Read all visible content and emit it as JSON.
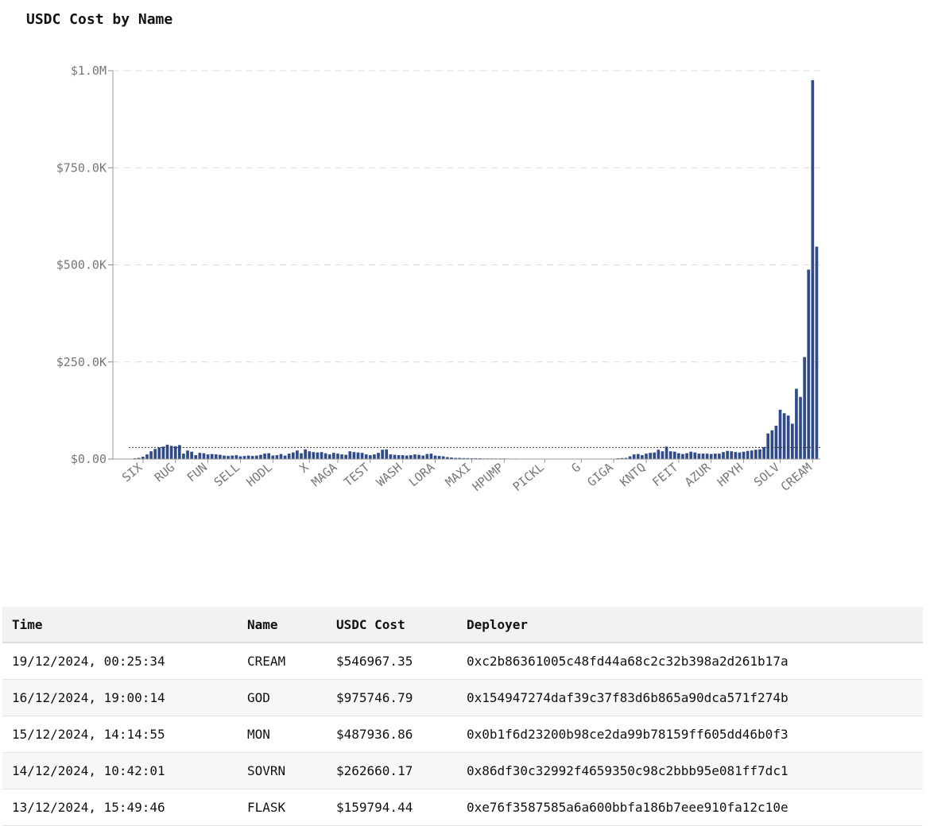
{
  "chart_title": "USDC Cost by Name",
  "chart_data": {
    "type": "bar",
    "title": "USDC Cost by Name",
    "ylim": [
      0,
      1000000
    ],
    "yticks": [
      {
        "value": 0,
        "label": "$0.00"
      },
      {
        "value": 250000,
        "label": "$250.0K"
      },
      {
        "value": 500000,
        "label": "$500.0K"
      },
      {
        "value": 750000,
        "label": "$750.0K"
      },
      {
        "value": 1000000,
        "label": "$1.0M"
      }
    ],
    "x_tick_labels": [
      {
        "index": 3,
        "label": "SIX"
      },
      {
        "index": 11,
        "label": "RUG"
      },
      {
        "index": 19,
        "label": "FUN"
      },
      {
        "index": 27,
        "label": "SELL"
      },
      {
        "index": 35,
        "label": "HODL"
      },
      {
        "index": 44,
        "label": "X"
      },
      {
        "index": 51,
        "label": "MAGA"
      },
      {
        "index": 59,
        "label": "TEST"
      },
      {
        "index": 67,
        "label": "WASH"
      },
      {
        "index": 75,
        "label": "LORA"
      },
      {
        "index": 84,
        "label": "MAXI"
      },
      {
        "index": 92,
        "label": "HPUMP"
      },
      {
        "index": 102,
        "label": "PICKL"
      },
      {
        "index": 111,
        "label": "G"
      },
      {
        "index": 119,
        "label": "GIGA"
      },
      {
        "index": 127,
        "label": "KNTQ"
      },
      {
        "index": 135,
        "label": "FEIT"
      },
      {
        "index": 143,
        "label": "AZUR"
      },
      {
        "index": 151,
        "label": "HPYH"
      },
      {
        "index": 160,
        "label": "SOLV"
      },
      {
        "index": 168,
        "label": "CREAM"
      }
    ],
    "values": [
      1000,
      2000,
      3000,
      6000,
      12000,
      20000,
      26000,
      30000,
      32000,
      37000,
      34000,
      33000,
      36000,
      14000,
      22000,
      19000,
      10000,
      16000,
      15000,
      12000,
      13000,
      12000,
      11000,
      9000,
      8000,
      9000,
      10000,
      7000,
      8000,
      9000,
      8000,
      9000,
      11000,
      14000,
      15000,
      9000,
      10000,
      13000,
      9000,
      14000,
      17000,
      22000,
      15000,
      25000,
      20000,
      18000,
      17000,
      18000,
      15000,
      12000,
      16000,
      14000,
      12000,
      11000,
      20000,
      18000,
      17000,
      16000,
      12000,
      10000,
      12000,
      16000,
      24000,
      25000,
      12000,
      11000,
      10000,
      10000,
      9000,
      10000,
      12000,
      11000,
      9000,
      13000,
      14000,
      9000,
      8000,
      7000,
      5000,
      4000,
      3000,
      3000,
      2500,
      2500,
      2000,
      2000,
      2000,
      1500,
      1500,
      1500,
      1500,
      1500,
      1500,
      1200,
      1200,
      1200,
      1000,
      1000,
      1000,
      1000,
      1000,
      1000,
      1000,
      1000,
      1000,
      1000,
      1000,
      1000,
      1000,
      1000,
      1000,
      1000,
      1000,
      1000,
      1000,
      1000,
      1000,
      1000,
      1000,
      1000,
      2000,
      2500,
      3000,
      7000,
      12000,
      13000,
      10000,
      14000,
      16000,
      17000,
      24000,
      20000,
      32000,
      20000,
      19000,
      15000,
      13000,
      15000,
      19000,
      17000,
      14000,
      14000,
      14000,
      13000,
      14000,
      14000,
      18000,
      21000,
      20000,
      18000,
      17000,
      19000,
      21000,
      22000,
      24000,
      25000,
      31000,
      66000,
      74000,
      86000,
      127000,
      118000,
      112000,
      91000,
      181000,
      160000,
      262660.17,
      487936.86,
      975746.79,
      546967.35
    ],
    "series_color": "#2f4b8b",
    "reference_line": {
      "value": 30000,
      "style": "dotted"
    },
    "grid": "horizontal dashed"
  },
  "table": {
    "columns": [
      "Time",
      "Name",
      "USDC Cost",
      "Deployer"
    ],
    "rows": [
      [
        "19/12/2024, 00:25:34",
        "CREAM",
        "$546967.35",
        "0xc2b86361005c48fd44a68c2c32b398a2d261b17a"
      ],
      [
        "16/12/2024, 19:00:14",
        "GOD",
        "$975746.79",
        "0x154947274daf39c37f83d6b865a90dca571f274b"
      ],
      [
        "15/12/2024, 14:14:55",
        "MON",
        "$487936.86",
        "0x0b1f6d23200b98ce2da99b78159ff605dd46b0f3"
      ],
      [
        "14/12/2024, 10:42:01",
        "SOVRN",
        "$262660.17",
        "0x86df30c32992f4659350c98c2bbb95e081ff7dc1"
      ],
      [
        "13/12/2024, 15:49:46",
        "FLASK",
        "$159794.44",
        "0xe76f3587585a6a600bbfa186b7eee910fa12c10e"
      ]
    ]
  }
}
